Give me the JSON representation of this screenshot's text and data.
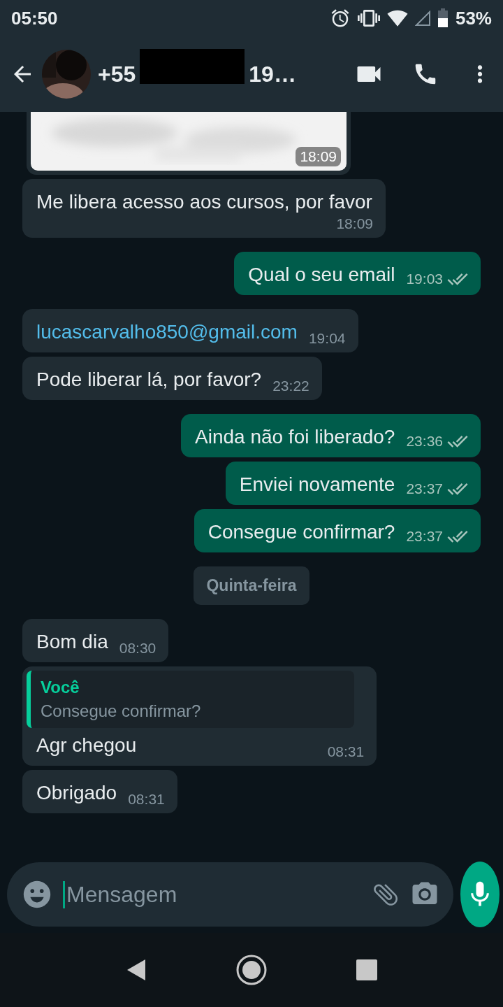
{
  "status_bar": {
    "time": "05:50",
    "battery": "53%"
  },
  "header": {
    "title_start": "+55",
    "title_end": "19…",
    "redacted": true
  },
  "messages": [
    {
      "outgoing": false,
      "time": "18:09"
    },
    {
      "kind": "text",
      "outgoing": false,
      "text": "Me libera acesso aos cursos, por favor",
      "time": "18:09"
    },
    {
      "kind": "text",
      "outgoing": true,
      "text": "Qual o seu email",
      "time": "19:03",
      "read": false
    },
    {
      "kind": "link",
      "outgoing": false,
      "text": "lucascarvalho850@gmail.com",
      "time": "19:04"
    },
    {
      "kind": "text",
      "outgoing": false,
      "text": "Pode liberar lá, por favor?",
      "time": "23:22"
    },
    {
      "kind": "text",
      "outgoing": true,
      "text": "Ainda não foi liberado?",
      "time": "23:36",
      "read": false
    },
    {
      "kind": "text",
      "outgoing": true,
      "text": "Enviei novamente",
      "time": "23:37",
      "read": false
    },
    {
      "kind": "text",
      "outgoing": true,
      "text": "Consegue confirmar?",
      "time": "23:37",
      "read": false
    },
    {
      "kind": "date",
      "text": "Quinta-feira"
    },
    {
      "kind": "text",
      "outgoing": false,
      "text": "Bom dia",
      "time": "08:30"
    },
    {
      "kind": "reply",
      "outgoing": false,
      "quote_author": "Você",
      "quote_text": "Consegue confirmar?",
      "text": "Agr chegou",
      "time": "08:31"
    },
    {
      "kind": "text",
      "outgoing": false,
      "text": "Obrigado",
      "time": "08:31"
    }
  ],
  "composer": {
    "placeholder": "Mensagem"
  }
}
